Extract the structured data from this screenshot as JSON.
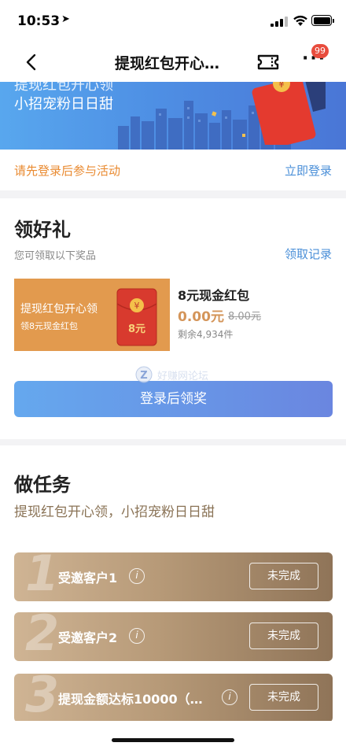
{
  "status_bar": {
    "time": "10:53",
    "location_icon": "location-arrow-icon"
  },
  "nav": {
    "title": "提现红包开心…",
    "badge": "99",
    "more_label": "···"
  },
  "banner": {
    "line1": "提现红包开心领",
    "line2": "小招宠粉日日甜"
  },
  "login": {
    "hint": "请先登录后参与活动",
    "link": "立即登录"
  },
  "gifts": {
    "title": "领好礼",
    "subtitle": "您可领取以下奖品",
    "record_link": "领取记录",
    "prize": {
      "image_title": "提现红包开心领",
      "image_sub": "领8元现金红包",
      "envelope_label": "8元",
      "envelope_symbol": "¥",
      "name": "8元现金红包",
      "price": "0.00元",
      "original_price": "8.00元",
      "stock": "剩余4,934件"
    },
    "watermark": "好赚网论坛",
    "claim_button": "登录后领奖"
  },
  "tasks": {
    "title": "做任务",
    "subtitle": "提现红包开心领，小招宠粉日日甜",
    "items": [
      {
        "num": "1",
        "label": "受邀客户1",
        "status": "未完成"
      },
      {
        "num": "2",
        "label": "受邀客户2",
        "status": "未完成"
      },
      {
        "num": "3",
        "label": "提现金额达标10000（…",
        "status": "未完成"
      }
    ]
  },
  "colors": {
    "accent_blue": "#4a8fd8",
    "accent_orange": "#e98a30",
    "gold": "#b79a78",
    "badge_red": "#e84c3d"
  }
}
